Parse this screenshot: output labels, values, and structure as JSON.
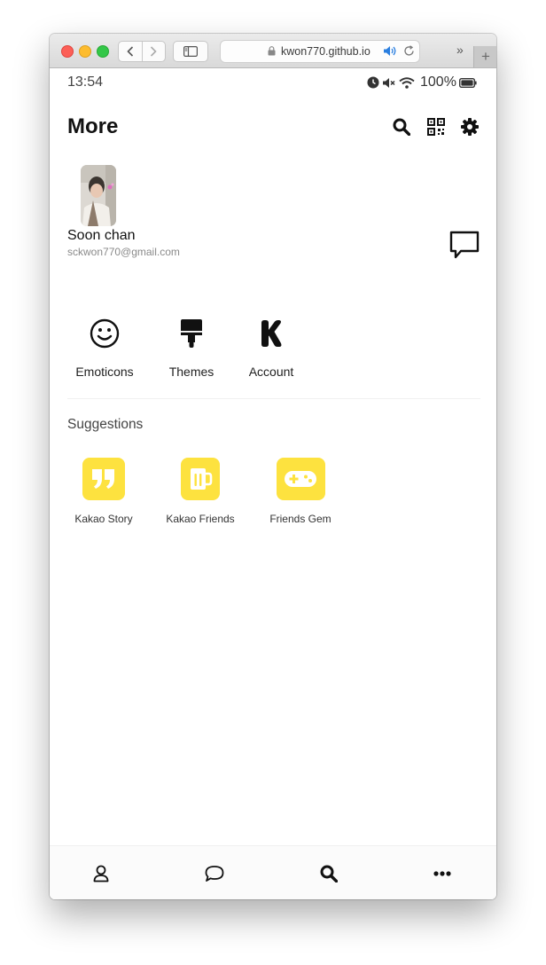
{
  "browser": {
    "url": "kwon770.github.io"
  },
  "status_bar": {
    "time": "13:54",
    "battery": "100%"
  },
  "header": {
    "title": "More"
  },
  "profile": {
    "name": "Soon chan",
    "email": "sckwon770@gmail.com"
  },
  "menu": [
    {
      "label": "Emoticons",
      "icon": "smile-icon"
    },
    {
      "label": "Themes",
      "icon": "paint-brush-icon"
    },
    {
      "label": "Account",
      "icon": "kakao-k-icon"
    }
  ],
  "suggestions": {
    "title": "Suggestions",
    "items": [
      {
        "label": "Kakao Story",
        "icon": "quote-icon"
      },
      {
        "label": "Kakao Friends",
        "icon": "beer-mug-icon"
      },
      {
        "label": "Friends Gem",
        "icon": "gamepad-icon"
      }
    ]
  },
  "bottom_nav": [
    {
      "name": "friends",
      "icon": "user-icon"
    },
    {
      "name": "chats",
      "icon": "chat-bubble-icon"
    },
    {
      "name": "find",
      "icon": "search-icon"
    },
    {
      "name": "more",
      "icon": "ellipsis-icon"
    }
  ],
  "colors": {
    "accent": "#fde23f",
    "text": "#111111",
    "muted": "#8a8a8a"
  }
}
